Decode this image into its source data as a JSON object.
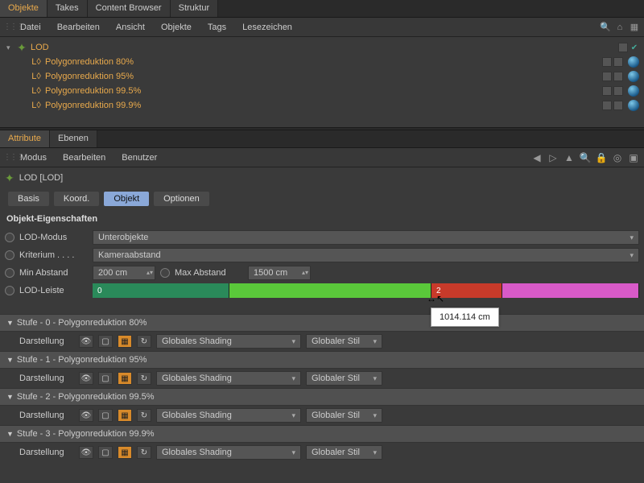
{
  "upper_tabs": [
    "Objekte",
    "Takes",
    "Content Browser",
    "Struktur"
  ],
  "upper_tab_active": 0,
  "upper_menu": [
    "Datei",
    "Bearbeiten",
    "Ansicht",
    "Objekte",
    "Tags",
    "Lesezeichen"
  ],
  "tree": {
    "root": {
      "label": "LOD"
    },
    "children": [
      {
        "label": "Polygonreduktion 80%"
      },
      {
        "label": "Polygonreduktion 95%"
      },
      {
        "label": "Polygonreduktion 99.5%"
      },
      {
        "label": "Polygonreduktion 99.9%"
      }
    ]
  },
  "lower_tabs": [
    "Attribute",
    "Ebenen"
  ],
  "lower_tab_active": 0,
  "attr_menu": [
    "Modus",
    "Bearbeiten",
    "Benutzer"
  ],
  "object_title": "LOD [LOD]",
  "attr_tabs": [
    "Basis",
    "Koord.",
    "Objekt",
    "Optionen"
  ],
  "attr_tab_active": 2,
  "section": "Objekt-Eigenschaften",
  "props": {
    "lod_modus_label": "LOD-Modus",
    "lod_modus_value": "Unterobjekte",
    "kriterium_label": "Kriterium . . . .",
    "kriterium_value": "Kameraabstand",
    "min_abstand_label": "Min Abstand",
    "min_abstand_value": "200 cm",
    "max_abstand_label": "Max Abstand",
    "max_abstand_value": "1500 cm",
    "leiste_label": "LOD-Leiste"
  },
  "lod_bar": {
    "segments": [
      {
        "label": "0",
        "width_pct": 25,
        "color": "#2a8a5a"
      },
      {
        "label": "",
        "width_pct": 37,
        "color": "#5ac83a"
      },
      {
        "label": "2",
        "width_pct": 13,
        "color": "#c83a2a"
      },
      {
        "label": "",
        "width_pct": 25,
        "color": "#d85ac8"
      }
    ],
    "tooltip": "1014.114 cm"
  },
  "stufen": [
    {
      "title": "Stufe - 0 - Polygonreduktion 80%"
    },
    {
      "title": "Stufe - 1 - Polygonreduktion 95%"
    },
    {
      "title": "Stufe - 2 - Polygonreduktion 99.5%"
    },
    {
      "title": "Stufe - 3 - Polygonreduktion 99.9%"
    }
  ],
  "darstellung_label": "Darstellung",
  "shading_value": "Globales Shading",
  "stil_value": "Globaler Stil"
}
